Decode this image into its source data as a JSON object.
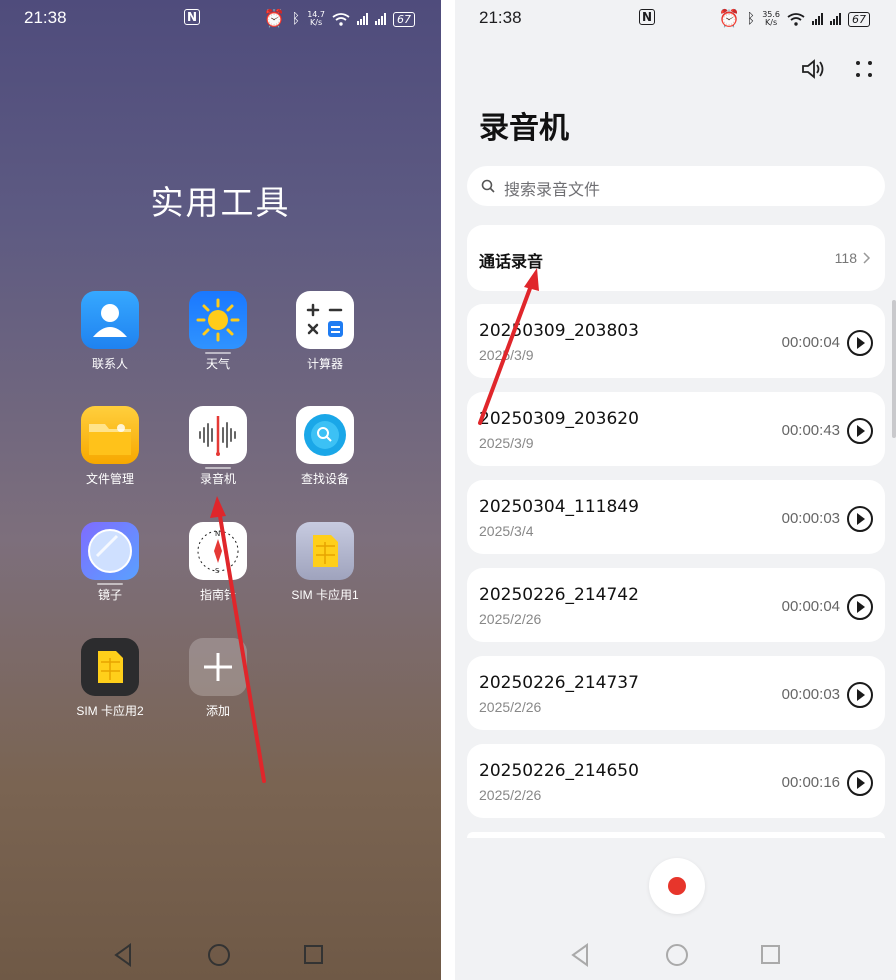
{
  "status_bar": {
    "time": "21:38",
    "left_speed": "14.7",
    "right_speed": "35.6",
    "speed_unit": "K/s",
    "battery": "67"
  },
  "folder": {
    "title": "实用工具",
    "apps": [
      {
        "label": "联系人",
        "icon": "contacts-icon"
      },
      {
        "label": "天气",
        "icon": "weather-icon"
      },
      {
        "label": "计算器",
        "icon": "calculator-icon"
      },
      {
        "label": "文件管理",
        "icon": "file-manager-icon"
      },
      {
        "label": "录音机",
        "icon": "recorder-icon"
      },
      {
        "label": "查找设备",
        "icon": "find-device-icon"
      },
      {
        "label": "镜子",
        "icon": "mirror-icon"
      },
      {
        "label": "指南针",
        "icon": "compass-icon"
      },
      {
        "label": "SIM 卡应用1",
        "icon": "sim-app-1-icon"
      },
      {
        "label": "SIM 卡应用2",
        "icon": "sim-app-2-icon"
      },
      {
        "label": "添加",
        "icon": "add-icon"
      }
    ]
  },
  "recorder": {
    "title": "录音机",
    "search_placeholder": "搜索录音文件",
    "call_recordings": {
      "label": "通话录音",
      "count": "118"
    },
    "recordings": [
      {
        "name": "20250309_203803",
        "date": "2025/3/9",
        "duration": "00:00:04"
      },
      {
        "name": "20250309_203620",
        "date": "2025/3/9",
        "duration": "00:00:43"
      },
      {
        "name": "20250304_111849",
        "date": "2025/3/4",
        "duration": "00:00:03"
      },
      {
        "name": "20250226_214742",
        "date": "2025/2/26",
        "duration": "00:00:04"
      },
      {
        "name": "20250226_214737",
        "date": "2025/2/26",
        "duration": "00:00:03"
      },
      {
        "name": "20250226_214650",
        "date": "2025/2/26",
        "duration": "00:00:16"
      }
    ]
  },
  "colors": {
    "annotation_arrow": "#e0262b",
    "record_dot": "#e7352b"
  }
}
